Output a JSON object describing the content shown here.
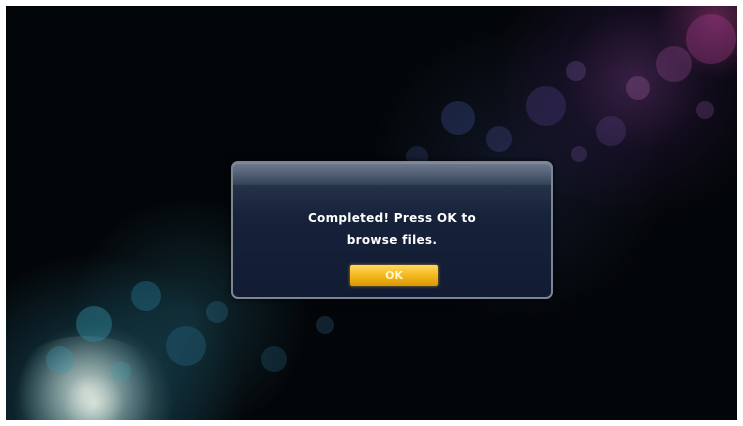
{
  "dialog": {
    "message_line1": "Completed! Press OK to",
    "message_line2": "browse files.",
    "ok_label": "OK"
  },
  "colors": {
    "background": "#030608",
    "dialog": "#16223a",
    "button": "#f1b51b"
  }
}
